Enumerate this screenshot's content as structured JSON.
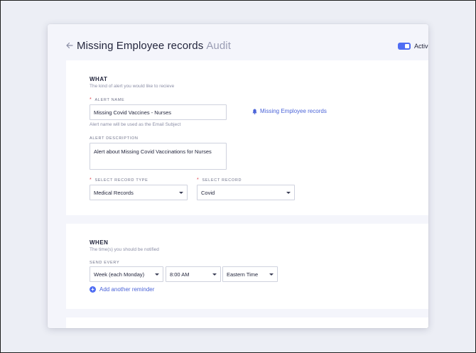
{
  "header": {
    "title": "Missing Employee records",
    "subtitle": "Audit",
    "toggle_label": "Active"
  },
  "what": {
    "title": "WHAT",
    "description": "The kind of alert you would like to recieve",
    "alert_name_label": "ALERT NAME",
    "alert_name_value": "Missing Covid Vaccines - Nurses",
    "alert_name_hint": "Alert name will be used as the Email Subject",
    "preview_link": "Missing Employee records",
    "alert_description_label": "ALERT DESCRIPTION",
    "alert_description_value": "Alert about Missing Covid Vaccinations for Nurses",
    "record_type_label": "SELECT RECORD TYPE",
    "record_type_value": "Medical Records",
    "record_label": "SELECT RECORD",
    "record_value": "Covid"
  },
  "when": {
    "title": "WHEN",
    "description": "The time(s) you should be notified",
    "send_every_label": "SEND EVERY",
    "frequency_value": "Week (each Monday)",
    "time_value": "8:00 AM",
    "timezone_value": "Eastern Time",
    "add_reminder_label": "Add another reminder"
  },
  "colors": {
    "accent": "#4f6df3",
    "link": "#4b64d8",
    "required": "#e0404a",
    "text": "#23263d"
  },
  "icons": {
    "back": "arrow-left-icon",
    "bell": "bell-icon",
    "add": "plus-circle-icon",
    "dropdown": "caret-down-icon"
  }
}
